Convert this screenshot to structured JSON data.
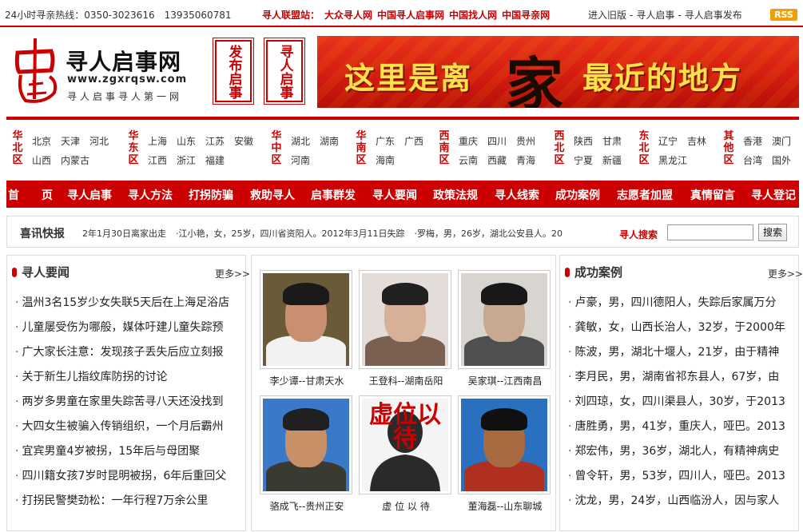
{
  "topbar": {
    "hotline": "24小时寻亲热线：0350-3023616　13935060781",
    "union": [
      "寻人联盟站：",
      "大众寻人网",
      "中国寻人启事网",
      "中国找人网",
      "中国寻亲网"
    ],
    "links": [
      "进入旧版",
      "寻人启事",
      "寻人启事发布"
    ],
    "rss": "RSS"
  },
  "header": {
    "logo_char": "中国",
    "logo_title": "寻人启事网",
    "logo_url": "www.zgxrqsw.com",
    "logo_slogan": "寻人启事寻人第一网",
    "box1": "发布启事",
    "box2": "寻人启事",
    "banner": {
      "part1": "这里是离",
      "highlight": "家",
      "part2": "最近的地方"
    }
  },
  "regions": [
    {
      "name": "华北区",
      "cities": [
        "北京",
        "天津",
        "河北",
        "山西",
        "内蒙古"
      ]
    },
    {
      "name": "华东区",
      "cities": [
        "上海",
        "山东",
        "江苏",
        "安徽",
        "江西",
        "浙江",
        "福建"
      ]
    },
    {
      "name": "华中区",
      "cities": [
        "湖北",
        "湖南",
        "河南"
      ]
    },
    {
      "name": "华南区",
      "cities": [
        "广东",
        "广西",
        "海南"
      ]
    },
    {
      "name": "西南区",
      "cities": [
        "重庆",
        "四川",
        "贵州",
        "云南",
        "西藏",
        "青海"
      ]
    },
    {
      "name": "西北区",
      "cities": [
        "陕西",
        "甘肃",
        "宁夏",
        "新疆"
      ]
    },
    {
      "name": "东北区",
      "cities": [
        "辽宁",
        "吉林",
        "黑龙江"
      ]
    },
    {
      "name": "其他区",
      "cities": [
        "香港",
        "澳门",
        "台湾",
        "国外"
      ]
    }
  ],
  "nav": [
    "首　　页",
    "寻人启事",
    "寻人方法",
    "打拐防骗",
    "救助寻人",
    "启事群发",
    "寻人要闻",
    "政策法规",
    "寻人线索",
    "成功案例",
    "志愿者加盟",
    "真情留言",
    "寻人登记"
  ],
  "ticker": {
    "label": "喜讯快报",
    "items": [
      "2年1月30日离家出走",
      "·江小艳，女，25岁，四川省资阳人。2012年3月11日失踪",
      "·罗梅，男，26岁，湖北公安县人。20"
    ],
    "search_label": "寻人搜索",
    "search_placeholder": "",
    "search_button": "搜索"
  },
  "news": {
    "title": "寻人要闻",
    "more": "更多>>",
    "items": [
      "温州3名15岁少女失联5天后在上海足浴店",
      "儿童屡受伤为哪般，媒体吁建儿童失踪预",
      "广大家长注意：发现孩子丢失后应立刻报",
      "关于新生儿指纹库防拐的讨论",
      "两岁多男童在家里失踪苦寻八天还没找到",
      "大四女生被骗入传销组织，一个月后霸州",
      "宜宾男童4岁被拐，15年后与母团聚",
      "四川籍女孩7岁时昆明被拐，6年后重回父",
      "打拐民警樊劲松：一年行程7万余公里"
    ]
  },
  "photos": [
    {
      "caption": "李少谭--甘肃天水",
      "skin": "#c89070",
      "bg": "#6a5a3a",
      "hair": "#1a1a1a",
      "shirt": "#f2f2f2"
    },
    {
      "caption": "王登科--湖南岳阳",
      "skin": "#d8b098",
      "bg": "#e4dcd8",
      "hair": "#202020",
      "shirt": "#7a6050"
    },
    {
      "caption": "吴家琪--江西南昌",
      "skin": "#c8a890",
      "bg": "#d8d4d0",
      "hair": "#181818",
      "shirt": "#505050"
    },
    {
      "caption": "骆成飞--贵州正安",
      "skin": "#c89068",
      "bg": "#3a78c8",
      "hair": "#202020",
      "shirt": "#3a3a30"
    },
    {
      "caption": "虚 位 以 待",
      "placeholder": "虚位以待"
    },
    {
      "caption": "董海磊--山东聊城",
      "skin": "#a86a40",
      "bg": "#2a70c0",
      "hair": "#101010",
      "shirt": "#b03020"
    }
  ],
  "cases": {
    "title": "成功案例",
    "more": "更多>>",
    "items": [
      "卢豪，男，四川德阳人，失踪后家属万分",
      "龚敏，女，山西长治人，32岁，于2000年",
      "陈波，男，湖北十堰人，21岁，由于精神",
      "李月民，男，湖南省祁东县人，67岁，由",
      "刘四琼，女，四川渠县人，30岁，于2013",
      "唐胜勇，男，41岁，重庆人，哑巴。2013",
      "郑宏伟，男，36岁，湖北人，有精神病史",
      "曾令轩，男，53岁，四川人，哑巴。2013",
      "沈龙，男，24岁，山西临汾人，因与家人"
    ]
  },
  "colors": {
    "brand_red": "#cc0000",
    "banner_yellow": "#ffe24a",
    "rss_orange": "#f0a000"
  }
}
